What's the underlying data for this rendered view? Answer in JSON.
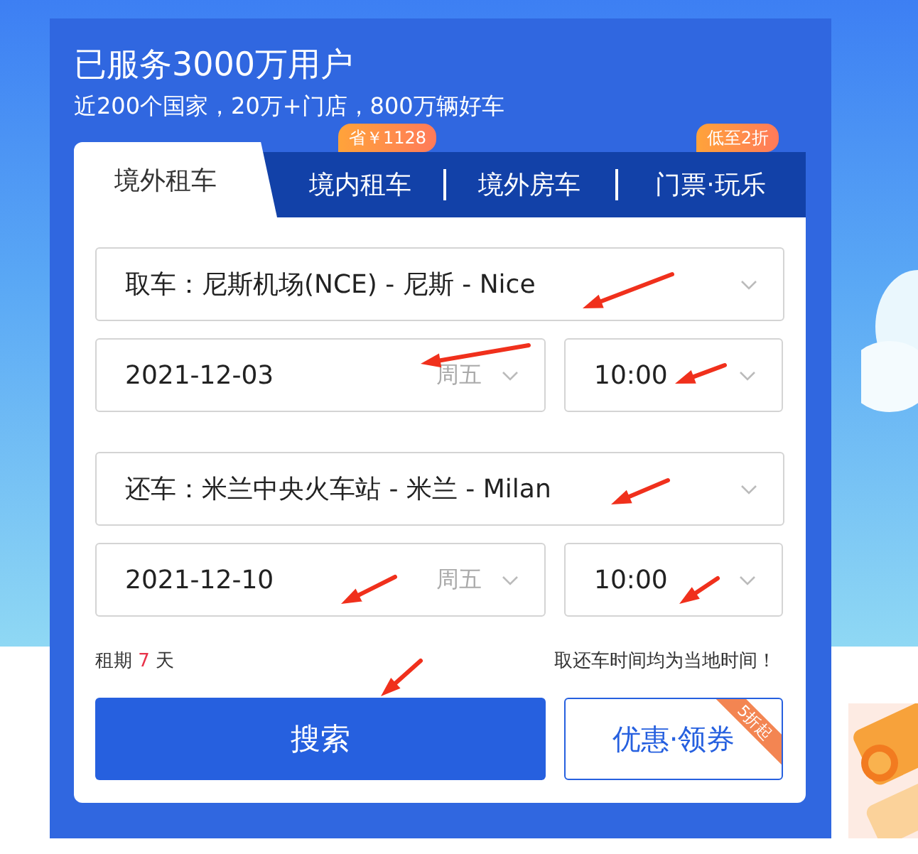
{
  "header": {
    "title": "已服务3000万用户",
    "subtitle": "近200个国家，20万+门店，800万辆好车"
  },
  "tabs": [
    {
      "label": "境外租车",
      "selected": true
    },
    {
      "label": "境内租车",
      "selected": false,
      "badge": "省￥1128"
    },
    {
      "label": "境外房车",
      "selected": false
    },
    {
      "label": "门票·玩乐",
      "selected": false,
      "badge": "低至2折"
    }
  ],
  "legs": [
    {
      "label": "取车：",
      "location": "尼斯机场(NCE) - 尼斯 - Nice",
      "date": "2021-12-03",
      "weekday": "周五",
      "time": "10:00"
    },
    {
      "label": "还车：",
      "location": "米兰中央火车站 - 米兰 - Milan",
      "date": "2021-12-10",
      "weekday": "周五",
      "time": "10:00"
    }
  ],
  "rental": {
    "prefix": "租期",
    "days": "7",
    "suffix": "天"
  },
  "note": "取还车时间均为当地时间！",
  "search_button": "搜索",
  "coupon_button": {
    "label": "优惠·领券",
    "ribbon": "5折起"
  }
}
